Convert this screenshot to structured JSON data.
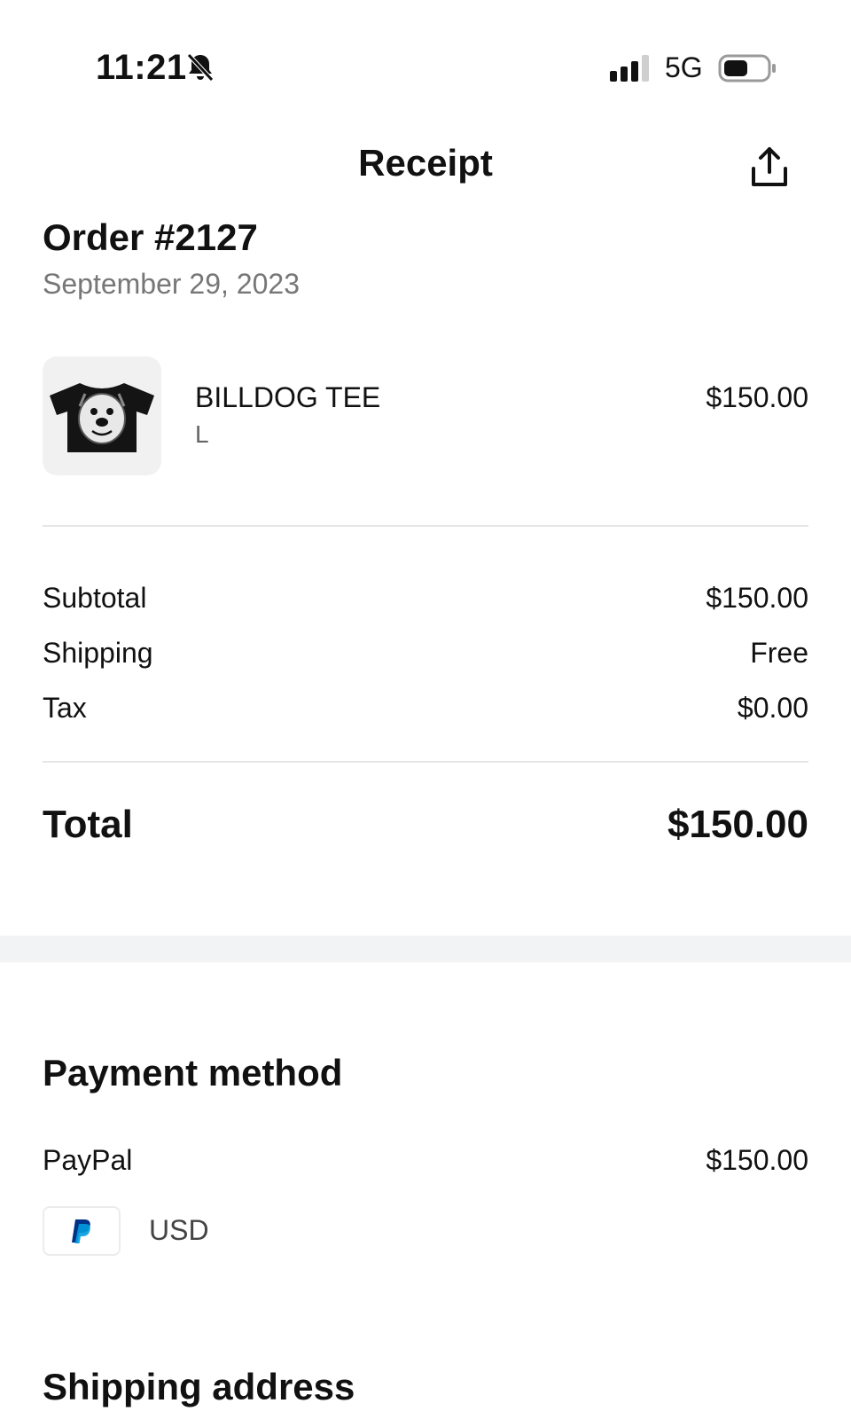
{
  "status_bar": {
    "time": "11:21",
    "network": "5G",
    "icons": [
      "bell-slash-icon",
      "signal-icon",
      "battery-icon"
    ]
  },
  "header": {
    "title": "Receipt",
    "share_icon": "share-icon"
  },
  "order": {
    "title": "Order #2127",
    "date": "September 29, 2023"
  },
  "item": {
    "name": "BILLDOG TEE",
    "variant": "L",
    "price": "$150.00",
    "image_icon": "tshirt-icon"
  },
  "summary": {
    "subtotal_label": "Subtotal",
    "subtotal_value": "$150.00",
    "shipping_label": "Shipping",
    "shipping_value": "Free",
    "tax_label": "Tax",
    "tax_value": "$0.00",
    "total_label": "Total",
    "total_value": "$150.00"
  },
  "payment": {
    "section_title": "Payment method",
    "method": "PayPal",
    "amount": "$150.00",
    "currency": "USD",
    "logo_icon": "paypal-icon"
  },
  "shipping_address": {
    "section_title": "Shipping address"
  },
  "colors": {
    "text": "#111111",
    "muted": "#777777",
    "divider": "#e6e6e6",
    "section_gap": "#f2f3f5",
    "paypal_dark": "#003087",
    "paypal_light": "#009cde"
  }
}
